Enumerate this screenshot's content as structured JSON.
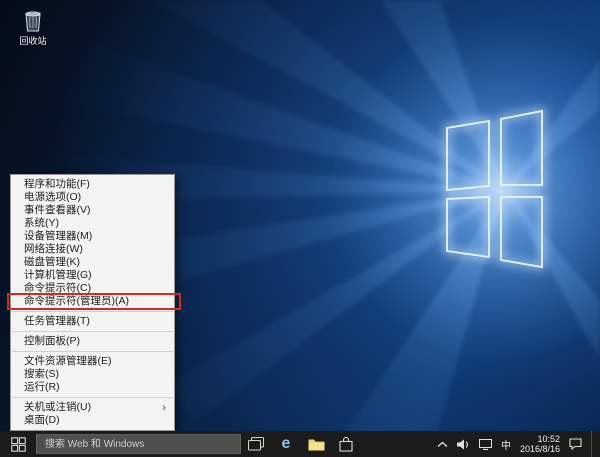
{
  "desktop": {
    "recycle_bin_label": "回收站"
  },
  "context_menu": {
    "highlight_color": "#d42a24",
    "submenu_arrow": "›",
    "items": [
      {
        "type": "item",
        "label": "程序和功能(F)"
      },
      {
        "type": "item",
        "label": "电源选项(O)"
      },
      {
        "type": "item",
        "label": "事件查看器(V)"
      },
      {
        "type": "item",
        "label": "系统(Y)"
      },
      {
        "type": "item",
        "label": "设备管理器(M)"
      },
      {
        "type": "item",
        "label": "网络连接(W)"
      },
      {
        "type": "item",
        "label": "磁盘管理(K)"
      },
      {
        "type": "item",
        "label": "计算机管理(G)"
      },
      {
        "type": "item",
        "label": "命令提示符(C)"
      },
      {
        "type": "item",
        "label": "命令提示符(管理员)(A)",
        "highlighted": true
      },
      {
        "type": "separator"
      },
      {
        "type": "item",
        "label": "任务管理器(T)"
      },
      {
        "type": "separator"
      },
      {
        "type": "item",
        "label": "控制面板(P)"
      },
      {
        "type": "separator"
      },
      {
        "type": "item",
        "label": "文件资源管理器(E)"
      },
      {
        "type": "item",
        "label": "搜索(S)"
      },
      {
        "type": "item",
        "label": "运行(R)"
      },
      {
        "type": "separator"
      },
      {
        "type": "item",
        "label": "关机或注销(U)",
        "submenu": true
      },
      {
        "type": "item",
        "label": "桌面(D)"
      }
    ]
  },
  "taskbar": {
    "search_placeholder": "搜索 Web 和 Windows",
    "edge_glyph": "e",
    "tray": {
      "ime_indicator": "中",
      "time": "10:52",
      "date": "2016/8/16"
    }
  }
}
